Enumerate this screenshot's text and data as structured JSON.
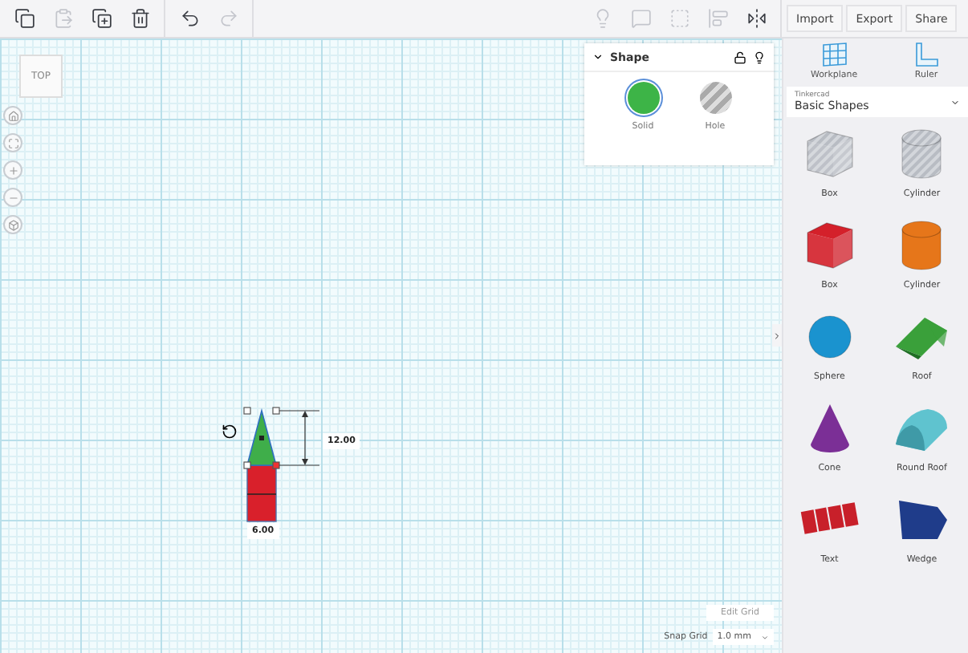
{
  "toolbar": {
    "tools": [
      {
        "kind": "copy",
        "disabled": false
      },
      {
        "kind": "paste",
        "disabled": true
      },
      {
        "kind": "duplicate",
        "disabled": false
      },
      {
        "kind": "delete",
        "disabled": false
      },
      {
        "kind": "undo",
        "disabled": false
      },
      {
        "kind": "redo",
        "disabled": true
      }
    ],
    "view_tools": [
      {
        "kind": "light",
        "disabled": true
      },
      {
        "kind": "group",
        "disabled": true
      },
      {
        "kind": "ungroup",
        "disabled": true
      },
      {
        "kind": "align",
        "disabled": true
      },
      {
        "kind": "mirror",
        "disabled": false
      }
    ],
    "actions": [
      "Import",
      "Export",
      "Share"
    ]
  },
  "view_cube": "TOP",
  "shape_panel": {
    "title": "Shape",
    "options": [
      {
        "kind": "solid",
        "label": "Solid",
        "selected": true
      },
      {
        "kind": "hole",
        "label": "Hole",
        "selected": false
      }
    ]
  },
  "canvas": {
    "height_dimension": "12.00",
    "width_dimension": "6.00",
    "edit_grid": "Edit Grid",
    "snap_grid_label": "Snap Grid",
    "snap_grid_value": "1.0 mm"
  },
  "sidebar": {
    "tools": [
      {
        "kind": "workplane",
        "label": "Workplane"
      },
      {
        "kind": "ruler",
        "label": "Ruler"
      }
    ],
    "library": {
      "caption": "Tinkercad",
      "value": "Basic Shapes"
    },
    "shapes": [
      {
        "kind": "box-hole",
        "label": "Box",
        "color": "#c8ccd2"
      },
      {
        "kind": "cylinder-hole",
        "label": "Cylinder",
        "color": "#c8ccd2"
      },
      {
        "kind": "box",
        "label": "Box",
        "color": "#d4202a"
      },
      {
        "kind": "cylinder",
        "label": "Cylinder",
        "color": "#e6761a"
      },
      {
        "kind": "sphere",
        "label": "Sphere",
        "color": "#1a93cf"
      },
      {
        "kind": "roof",
        "label": "Roof",
        "color": "#3aa03a"
      },
      {
        "kind": "cone",
        "label": "Cone",
        "color": "#7b2f96"
      },
      {
        "kind": "round-roof",
        "label": "Round Roof",
        "color": "#5fc3cf"
      },
      {
        "kind": "text",
        "label": "Text",
        "color": "#c8202a"
      },
      {
        "kind": "wedge",
        "label": "Wedge",
        "color": "#1f3c8a"
      }
    ]
  }
}
